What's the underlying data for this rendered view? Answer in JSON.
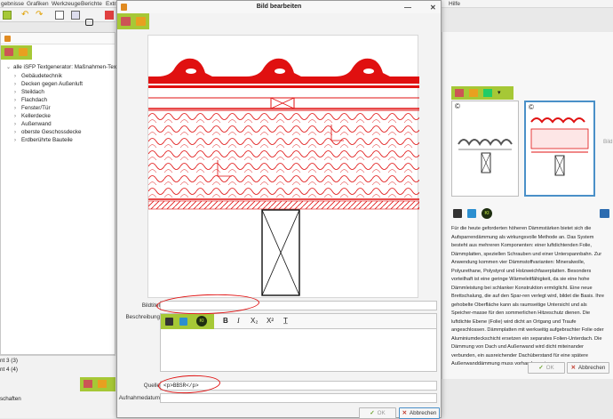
{
  "menubar": {
    "items": [
      "gebnisse",
      "Grafiken",
      "Werkzeuge",
      "Berichte",
      "Extras",
      "Hilfe"
    ]
  },
  "tree": {
    "root": "alle iSFP Textgenerator: Maßnahmen-Texte",
    "items": [
      "Gebäudetechnik",
      "Decken gegen Außenluft",
      "Steildach",
      "Flachdach",
      "Fenster/Tür",
      "Kellerdecke",
      "Außenwand",
      "oberste Geschossdecke",
      "Erdberührte Bauteile"
    ]
  },
  "bottom_left": {
    "row1": "nt 3 (3)",
    "row2": "nt 4 (4)",
    "row3": "schaften"
  },
  "dialog": {
    "title": "Bild bearbeiten",
    "labels": {
      "caption": "Bildtitel",
      "description": "Beschreibung",
      "source": "Quelle",
      "date": "Aufnahmedatum"
    },
    "caption_value": "",
    "source_value": "<p>BBSR</p>",
    "date_value": "",
    "rte": {
      "bold": "B",
      "italic": "I",
      "subscript": "X₂",
      "superscript": "X²",
      "clear": "T̲",
      "ki": "KI"
    },
    "ok": "OK",
    "cancel": "Abbrechen"
  },
  "right_panel": {
    "copyright": "©",
    "bild_hint": "Bild",
    "ki": "KI",
    "text": "Für die heute geforderten höheren Dämmstärken bietet sich die Aufsparrendämmung als wirkungsvolle Methode an. Das System besteht aus mehreren Komponenten: einer luftdichtenden Folie, Dämmplatten, speziellen Schrauben und einer Unterspannbahn. Zur Anwendung kommen vier Dämmstoffvarianten: Mineralwolle, Polyurethane, Polystyrol und Holzweichfaserplatten. Besonders vorteilhaft ist eine geringe Wärmeleitfähigkeit, da sie eine hohe Dämmleistung bei schlanker Konstruktion ermöglicht. Eine neue Brettschalung, die auf den Spar-ren verlegt wird, bildet die Basis. Ihre gehobelte Oberfläche kann als raumseitige Untersicht und als Speicher-masse für den sommerlichen Hitzeschutz dienen. Die luftdichte Ebene (Folie) wird dicht an Ortgang und Traufe angeschlossen. Dämmplatten mit werkseitig aufgebrachter Folie oder Aluminiumdeckschicht ersetzen ein separates Folien-Unterdach. Die Dämmung von Dach und Außenwand wird dicht miteinander verbunden, ein ausreichender Dachüberstand für eine spätere Außenwanddämmung muss vorhanden sein.",
    "ok": "OK",
    "cancel": "Abbrechen"
  },
  "colors": {
    "accent_green": "#a6c836",
    "drawing_red": "#e01010",
    "selection_blue": "#4a90c8"
  }
}
